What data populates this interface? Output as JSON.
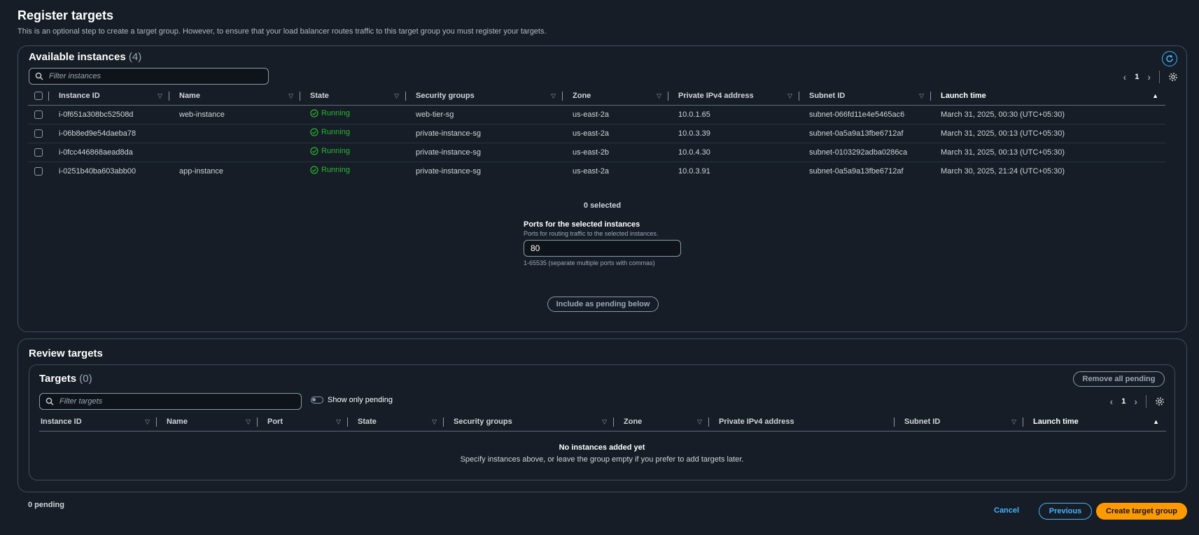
{
  "page": {
    "title": "Register targets",
    "description": "This is an optional step to create a target group. However, to ensure that your load balancer routes traffic to this target group you must register your targets."
  },
  "available": {
    "heading": "Available instances",
    "count": "(4)",
    "filter_placeholder": "Filter instances",
    "page_number": "1",
    "columns": [
      "Instance ID",
      "Name",
      "State",
      "Security groups",
      "Zone",
      "Private IPv4 address",
      "Subnet ID",
      "Launch time"
    ],
    "rows": [
      {
        "instance_id": "i-0f651a308bc52508d",
        "name": "web-instance",
        "state": "Running",
        "security_group": "web-tier-sg",
        "zone": "us-east-2a",
        "ip": "10.0.1.65",
        "subnet": "subnet-066fd11e4e5465ac6",
        "launch": "March 31, 2025, 00:30 (UTC+05:30)"
      },
      {
        "instance_id": "i-06b8ed9e54daeba78",
        "name": "",
        "state": "Running",
        "security_group": "private-instance-sg",
        "zone": "us-east-2a",
        "ip": "10.0.3.39",
        "subnet": "subnet-0a5a9a13fbe6712af",
        "launch": "March 31, 2025, 00:13 (UTC+05:30)"
      },
      {
        "instance_id": "i-0fcc446868aead8da",
        "name": "",
        "state": "Running",
        "security_group": "private-instance-sg",
        "zone": "us-east-2b",
        "ip": "10.0.4.30",
        "subnet": "subnet-0103292adba0286ca",
        "launch": "March 31, 2025, 00:13 (UTC+05:30)"
      },
      {
        "instance_id": "i-0251b40ba603abb00",
        "name": "app-instance",
        "state": "Running",
        "security_group": "private-instance-sg",
        "zone": "us-east-2a",
        "ip": "10.0.3.91",
        "subnet": "subnet-0a5a9a13fbe6712af",
        "launch": "March 30, 2025, 21:24 (UTC+05:30)"
      }
    ],
    "selected_text": "0 selected",
    "ports_label": "Ports for the selected instances",
    "ports_desc": "Ports for routing traffic to the selected instances.",
    "ports_value": "80",
    "ports_hint": "1-65535 (separate multiple ports with commas)",
    "include_button": "Include as pending below"
  },
  "review": {
    "heading": "Review targets",
    "targets_heading": "Targets",
    "targets_count": "(0)",
    "remove_button": "Remove all pending",
    "filter_placeholder": "Filter targets",
    "toggle_label": "Show only pending",
    "page_number": "1",
    "columns": [
      "Instance ID",
      "Name",
      "Port",
      "State",
      "Security groups",
      "Zone",
      "Private IPv4 address",
      "Subnet ID",
      "Launch time"
    ],
    "empty_title": "No instances added yet",
    "empty_desc": "Specify instances above, or leave the group empty if you prefer to add targets later."
  },
  "footer": {
    "pending_text": "0 pending",
    "cancel": "Cancel",
    "previous": "Previous",
    "create": "Create target group"
  },
  "colors": {
    "background": "#161d26",
    "accent": "#42b4ff",
    "primary_button": "#ff9900",
    "running": "#2bb534"
  }
}
